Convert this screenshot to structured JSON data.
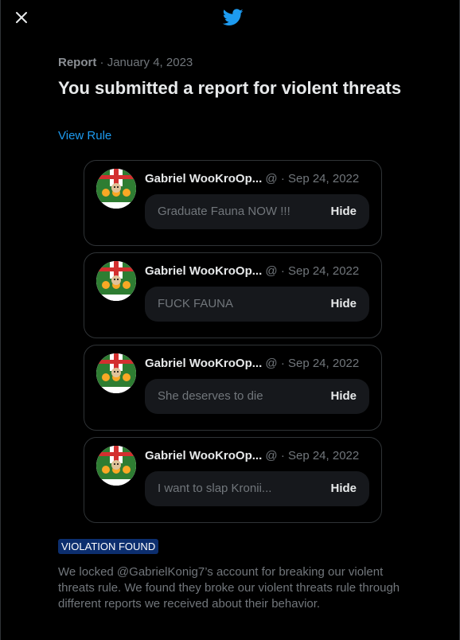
{
  "header": {
    "close_icon": "close-icon",
    "logo_icon": "twitter-bird-icon"
  },
  "report": {
    "kind": "Report",
    "separator": "·",
    "date": "January 4, 2023",
    "title": "You submitted a report for violent threats",
    "view_rule": "View Rule"
  },
  "tweets": [
    {
      "name": "Gabriel WooKroOp...",
      "handle": "@",
      "dot": "·",
      "date": "Sep 24, 2022",
      "text": "Graduate Fauna NOW !!!",
      "hide": "Hide"
    },
    {
      "name": "Gabriel WooKroOp...",
      "handle": "@",
      "dot": "·",
      "date": "Sep 24, 2022",
      "text": "FUCK FAUNA",
      "hide": "Hide"
    },
    {
      "name": "Gabriel WooKroOp...",
      "handle": "@",
      "dot": "·",
      "date": "Sep 24, 2022",
      "text": "She deserves to die",
      "hide": "Hide"
    },
    {
      "name": "Gabriel WooKroOp...",
      "handle": "@",
      "dot": "·",
      "date": "Sep 24, 2022",
      "text": "I want to slap Kronii...",
      "hide": "Hide"
    }
  ],
  "verdict": {
    "badge": "VIOLATION FOUND",
    "description": "We locked @GabrielKonig7’s account for breaking our violent threats rule. We found they broke our violent threats rule through different reports we received about their behavior."
  },
  "colors": {
    "accent": "#1d9bf0",
    "badge_bg": "#0c2e6e",
    "background": "#000000"
  }
}
